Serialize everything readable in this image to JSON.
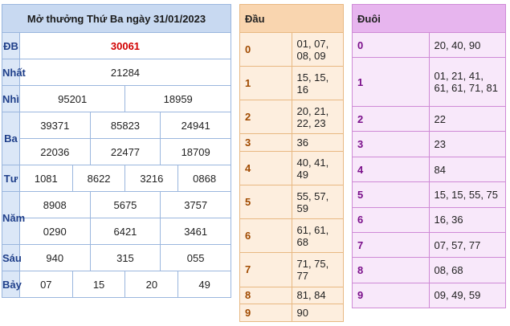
{
  "results": {
    "title": "Mở thưởng Thứ Ba ngày 31/01/2023",
    "rows": {
      "db": {
        "label": "ĐB",
        "values": [
          "30061"
        ]
      },
      "nhat": {
        "label": "Nhất",
        "values": [
          "21284"
        ]
      },
      "nhi": {
        "label": "Nhì",
        "values": [
          "95201",
          "18959"
        ]
      },
      "ba": {
        "label": "Ba",
        "values": [
          "39371",
          "85823",
          "24941",
          "22036",
          "22477",
          "18709"
        ]
      },
      "tu": {
        "label": "Tư",
        "values": [
          "1081",
          "8622",
          "3216",
          "0868"
        ]
      },
      "nam": {
        "label": "Năm",
        "values": [
          "8908",
          "5675",
          "3757",
          "0290",
          "6421",
          "3461"
        ]
      },
      "sau": {
        "label": "Sáu",
        "values": [
          "940",
          "315",
          "055"
        ]
      },
      "bay": {
        "label": "Bảy",
        "values": [
          "07",
          "15",
          "20",
          "49"
        ]
      }
    }
  },
  "dau": {
    "header": "Đầu",
    "rows": [
      {
        "num": "0",
        "values": "01, 07, 08, 09"
      },
      {
        "num": "1",
        "values": "15, 15, 16"
      },
      {
        "num": "2",
        "values": "20, 21, 22, 23"
      },
      {
        "num": "3",
        "values": "36"
      },
      {
        "num": "4",
        "values": "40, 41, 49"
      },
      {
        "num": "5",
        "values": "55, 57, 59"
      },
      {
        "num": "6",
        "values": "61, 61, 68"
      },
      {
        "num": "7",
        "values": "71, 75, 77"
      },
      {
        "num": "8",
        "values": "81, 84"
      },
      {
        "num": "9",
        "values": "90"
      }
    ]
  },
  "duoi": {
    "header": "Đuôi",
    "rows": [
      {
        "num": "0",
        "values": "20, 40, 90"
      },
      {
        "num": "1",
        "values": "01, 21, 41, 61, 61, 71, 81"
      },
      {
        "num": "2",
        "values": "22"
      },
      {
        "num": "3",
        "values": "23"
      },
      {
        "num": "4",
        "values": "84"
      },
      {
        "num": "5",
        "values": "15, 15, 55, 75"
      },
      {
        "num": "6",
        "values": "16, 36"
      },
      {
        "num": "7",
        "values": "07, 57, 77"
      },
      {
        "num": "8",
        "values": "08, 68"
      },
      {
        "num": "9",
        "values": "09, 49, 59"
      }
    ]
  },
  "colors": {
    "results_header": "#c8d9f1",
    "special_prize": "#d10000",
    "dau_header": "#f9d5af",
    "duoi_header": "#e7b5ee"
  }
}
